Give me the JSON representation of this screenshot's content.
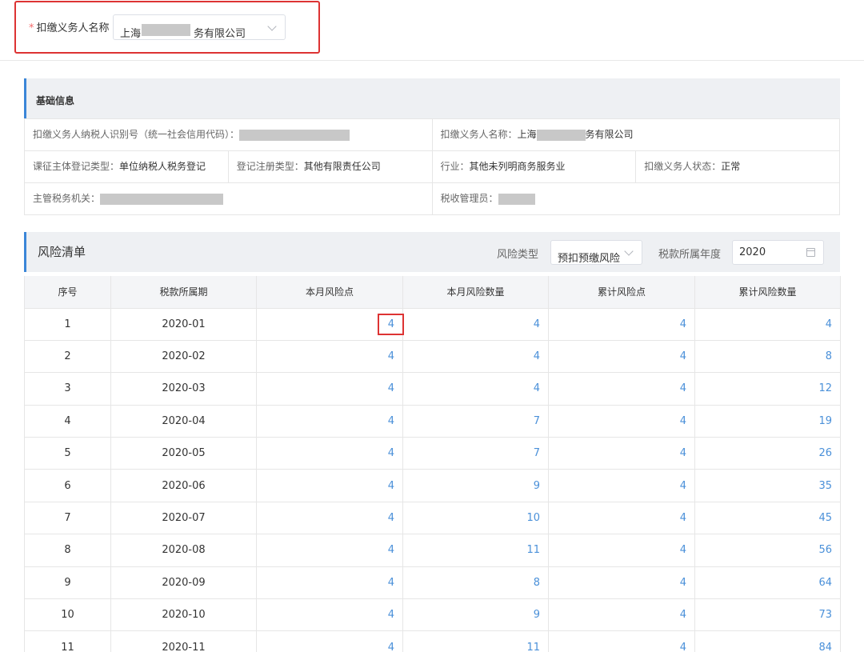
{
  "header": {
    "required_mark": "*",
    "agent_label": "扣缴义务人名称",
    "agent_value_part1": "上海",
    "agent_value_part2": "务有限公司"
  },
  "basic_info": {
    "title": "基础信息",
    "taxpayer_id_label": "扣缴义务人纳税人识别号（统一社会信用代码）：",
    "agent_name_label": "扣缴义务人名称：",
    "agent_name_part1": "上海",
    "agent_name_part2": "务有限公司",
    "levy_type_label": "课征主体登记类型：",
    "levy_type_value": "单位纳税人税务登记",
    "reg_type_label": "登记注册类型：",
    "reg_type_value": "其他有限责任公司",
    "industry_label": "行业：",
    "industry_value": "其他未列明商务服务业",
    "status_label": "扣缴义务人状态：",
    "status_value": "正常",
    "tax_office_label": "主管税务机关：",
    "tax_admin_label": "税收管理员："
  },
  "risk_list": {
    "title": "风险清单",
    "risk_type_label": "风险类型",
    "risk_type_value": "预扣预缴风险",
    "year_label": "税款所属年度",
    "year_value": "2020",
    "columns": [
      "序号",
      "税款所属期",
      "本月风险点",
      "本月风险数量",
      "累计风险点",
      "累计风险数量"
    ],
    "rows": [
      [
        "1",
        "2020-01",
        "4",
        "4",
        "4",
        "4"
      ],
      [
        "2",
        "2020-02",
        "4",
        "4",
        "4",
        "8"
      ],
      [
        "3",
        "2020-03",
        "4",
        "4",
        "4",
        "12"
      ],
      [
        "4",
        "2020-04",
        "4",
        "7",
        "4",
        "19"
      ],
      [
        "5",
        "2020-05",
        "4",
        "7",
        "4",
        "26"
      ],
      [
        "6",
        "2020-06",
        "4",
        "9",
        "4",
        "35"
      ],
      [
        "7",
        "2020-07",
        "4",
        "10",
        "4",
        "45"
      ],
      [
        "8",
        "2020-08",
        "4",
        "11",
        "4",
        "56"
      ],
      [
        "9",
        "2020-09",
        "4",
        "8",
        "4",
        "64"
      ],
      [
        "10",
        "2020-10",
        "4",
        "9",
        "4",
        "73"
      ],
      [
        "11",
        "2020-11",
        "4",
        "11",
        "4",
        "84"
      ]
    ]
  },
  "colors": {
    "accent": "#3b86d8",
    "link": "#4a90d9",
    "highlight": "#dd3333"
  }
}
